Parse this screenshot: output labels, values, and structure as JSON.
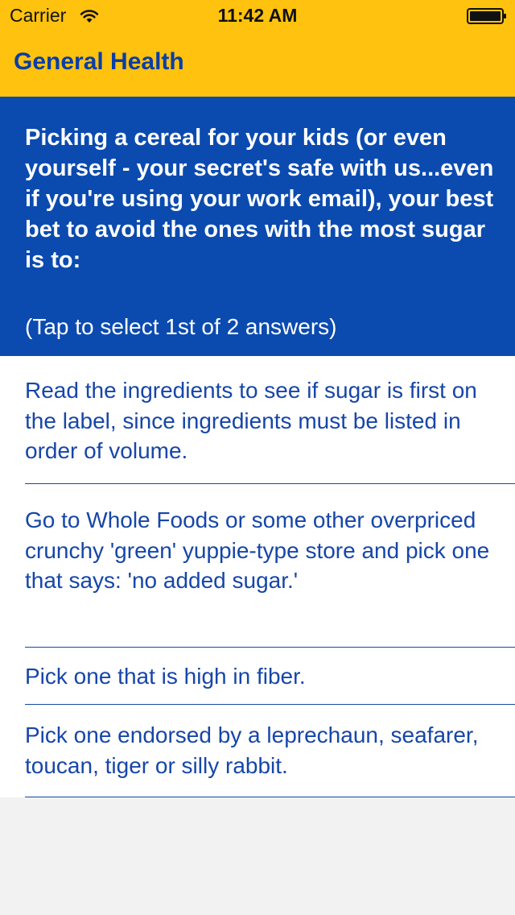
{
  "status_bar": {
    "carrier": "Carrier",
    "time": "11:42 AM",
    "wifi_icon": "wifi-icon",
    "battery_icon": "battery-icon"
  },
  "nav": {
    "title": "General Health"
  },
  "question": {
    "text": "Picking a cereal for your kids (or even yourself - your secret's safe with us...even if you're using your work email), your best bet to avoid the ones with the most sugar is to:",
    "instruction": "(Tap to select 1st of 2 answers)"
  },
  "answers": [
    {
      "label": "Read the ingredients to see if sugar is first on the label, since ingredients must be listed in order of volume."
    },
    {
      "label": "Go to Whole Foods or some other overpriced crunchy 'green' yuppie-type store and pick one that says: 'no added sugar.'"
    },
    {
      "label": "Pick one that is high in fiber."
    },
    {
      "label": "Pick one endorsed by a leprechaun, seafarer, toucan, tiger or silly rabbit."
    }
  ],
  "colors": {
    "header_yellow": "#ffc20e",
    "question_blue": "#0b4bb0",
    "answer_text_blue": "#1646a8",
    "background_gray": "#f2f2f2"
  }
}
